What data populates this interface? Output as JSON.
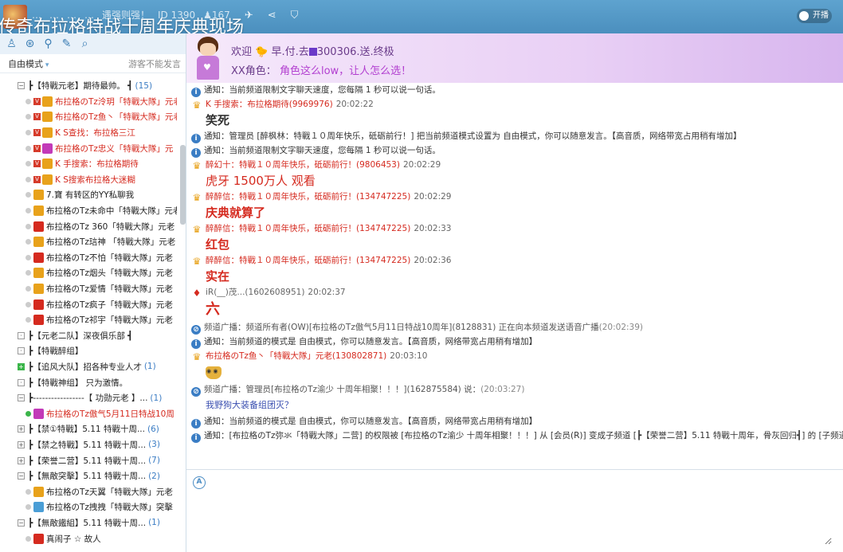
{
  "header": {
    "faded_text": [
      "…",
      "…",
      "…",
      "…",
      "遇强则强！",
      "ID 1390",
      "♟167"
    ],
    "channel_title": "传奇布拉格特战十周年庆典现场",
    "toggle_label": "开播"
  },
  "left": {
    "mode_label": "自由模式",
    "guest_notice": "游客不能发言",
    "tree": [
      {
        "kind": "group",
        "expander": "−",
        "text": "┣【特戰元老】期待最帅。 ┫",
        "count": "(15)",
        "color": "#222",
        "indent": 22
      },
      {
        "kind": "user",
        "text": "布拉格のTz泠玥「特戰大隊」元老",
        "color": "#d52a1f",
        "indent": 32,
        "v": true,
        "av": "#e8a21b"
      },
      {
        "kind": "user",
        "text": "布拉格のTz鱼丶「特戰大隊」元老",
        "color": "#d52a1f",
        "indent": 32,
        "v": true,
        "av": "#e8a21b"
      },
      {
        "kind": "user",
        "text": "K S查找：布拉格三江",
        "color": "#d52a1f",
        "indent": 32,
        "v": true,
        "av": "#e8a21b"
      },
      {
        "kind": "user",
        "text": "布拉格のTz忠义「特戰大隊」元",
        "color": "#d52a1f",
        "indent": 32,
        "v": true,
        "av": "#c23ab8"
      },
      {
        "kind": "user",
        "text": "K 手搜索：布拉格期待",
        "color": "#d52a1f",
        "indent": 32,
        "v": true,
        "av": "#e8a21b"
      },
      {
        "kind": "user",
        "text": "K S搜索布拉格大迷糊",
        "color": "#d52a1f",
        "indent": 32,
        "v": true,
        "av": "#e8a21b"
      },
      {
        "kind": "user",
        "text": "7.寶 有转区的YY私聊我",
        "color": "#222",
        "indent": 32,
        "v": false,
        "av": "#e8a21b"
      },
      {
        "kind": "user",
        "text": "布拉格のTz未命中「特戰大隊」元老",
        "color": "#222",
        "indent": 32,
        "v": false,
        "av": "#e8a21b"
      },
      {
        "kind": "user",
        "text": "布拉格のTz 360「特戰大隊」元老",
        "color": "#222",
        "indent": 32,
        "v": false,
        "av": "#d52a1f"
      },
      {
        "kind": "user",
        "text": "布拉格のTz琂神 「特戰大隊」元老",
        "color": "#222",
        "indent": 32,
        "v": false,
        "av": "#e8a21b"
      },
      {
        "kind": "user",
        "text": "布拉格のTz不怕「特戰大隊」元老",
        "color": "#222",
        "indent": 32,
        "v": false,
        "av": "#d52a1f"
      },
      {
        "kind": "user",
        "text": "布拉格のTz烟头「特戰大隊」元老",
        "color": "#222",
        "indent": 32,
        "v": false,
        "av": "#e8a21b"
      },
      {
        "kind": "user",
        "text": "布拉格のTz爱情「特戰大隊」元老",
        "color": "#222",
        "indent": 32,
        "v": false,
        "av": "#e8a21b"
      },
      {
        "kind": "user",
        "text": "布拉格のTz疯子「特戰大隊」元老",
        "color": "#222",
        "indent": 32,
        "v": false,
        "av": "#d52a1f"
      },
      {
        "kind": "user",
        "text": "布拉格のTz祁宇「特戰大隊」元老",
        "color": "#222",
        "indent": 32,
        "v": false,
        "av": "#d52a1f"
      },
      {
        "kind": "group",
        "expander": "·",
        "text": "┣【元老二队】深夜俱乐部 ┫",
        "count": "",
        "color": "#222",
        "indent": 22
      },
      {
        "kind": "group",
        "expander": "·",
        "text": "┣【特戰醉组】",
        "count": "",
        "color": "#222",
        "indent": 22
      },
      {
        "kind": "group",
        "expander": "+",
        "green": true,
        "text": "┣【追风大队】招各种专业人才",
        "count": "(1)",
        "color": "#222",
        "indent": 22
      },
      {
        "kind": "group",
        "expander": "·",
        "text": "┣【特戰神组】 只为激情。",
        "count": "",
        "color": "#222",
        "indent": 22
      },
      {
        "kind": "group",
        "expander": "−",
        "text": "┣-----------------【 功勋元老 】...",
        "count": "(1)",
        "color": "#222",
        "indent": 22
      },
      {
        "kind": "user",
        "text": "布拉格のTz傲气5月11日特战10周",
        "color": "#d52a1f",
        "indent": 32,
        "v": false,
        "av": "#c23ab8",
        "dotgreen": true
      },
      {
        "kind": "group",
        "expander": "+",
        "text": "┣【禁①特戰】5.11 特戰十周...",
        "count": "(6)",
        "color": "#222",
        "indent": 22
      },
      {
        "kind": "group",
        "expander": "+",
        "text": "┣【禁之特戰】5.11 特戰十周...",
        "count": "(3)",
        "color": "#222",
        "indent": 22
      },
      {
        "kind": "group",
        "expander": "+",
        "text": "┣【荣誉二营】5.11 特戰十周...",
        "count": "(7)",
        "color": "#222",
        "indent": 22
      },
      {
        "kind": "group",
        "expander": "−",
        "text": "┣【無敵突擊】5.11 特戰十周...",
        "count": "(2)",
        "color": "#222",
        "indent": 22
      },
      {
        "kind": "user",
        "text": "布拉格のTz天翼「特戰大隊」元老",
        "color": "#222",
        "indent": 32,
        "v": false,
        "av": "#e8a21b"
      },
      {
        "kind": "user",
        "text": "布拉格のTz拽拽「特戰大隊」突擊",
        "color": "#222",
        "indent": 32,
        "v": false,
        "av": "#4a9ed6"
      },
      {
        "kind": "group",
        "expander": "−",
        "text": "┣【無敵鐵組】5.11 特戰十周...",
        "count": "(1)",
        "color": "#222",
        "indent": 22
      },
      {
        "kind": "user",
        "text": "真闹子 ☆ 故人",
        "color": "#222",
        "indent": 32,
        "v": false,
        "av": "#d52a1f"
      }
    ]
  },
  "banner": {
    "welcome": "欢迎",
    "welcome_name": "早.付.去",
    "welcome_id": "300306.送.终极",
    "role_prefix": "XX角色：",
    "role_text": "角色这么low，让人怎么选！"
  },
  "chat": [
    {
      "type": "notice",
      "icon": "i",
      "text": "通知：当前频道限制文字聊天速度，您每隔 1 秒可以说一句话。"
    },
    {
      "type": "sender",
      "icon": "crown",
      "name": "K 手搜索：布拉格期待(9969976)",
      "time": "20:02:22"
    },
    {
      "type": "body",
      "text": "笑死",
      "color": "#333",
      "size": 15,
      "weight": "bold"
    },
    {
      "type": "notice",
      "icon": "i",
      "text": "通知：管理员 [醉枫林：特戰１０周年快乐，砥砺前行！] 把当前频道模式设置为 自由模式，你可以随意发言。【高音质，网络带宽占用稍有增加】"
    },
    {
      "type": "notice",
      "icon": "i",
      "text": "通知：当前频道限制文字聊天速度，您每隔 1 秒可以说一句话。"
    },
    {
      "type": "sender",
      "icon": "crown",
      "name": "醉幻十：特戰１０周年快乐，砥砺前行！(9806453)",
      "time": "20:02:29"
    },
    {
      "type": "body",
      "text": "虎牙  1500万人  观看",
      "color": "#d52a1f",
      "size": 15,
      "weight": "normal"
    },
    {
      "type": "sender",
      "icon": "crown",
      "name": "醉醉信：特戰１０周年快乐，砥砺前行！(134747225)",
      "time": "20:02:29"
    },
    {
      "type": "body",
      "text": "庆典就算了",
      "color": "#d52a1f",
      "size": 15,
      "weight": "bold"
    },
    {
      "type": "sender",
      "icon": "crown",
      "name": "醉醉信：特戰１０周年快乐，砥砺前行！(134747225)",
      "time": "20:02:33"
    },
    {
      "type": "body",
      "text": "红包",
      "color": "#d52a1f",
      "size": 15,
      "weight": "bold"
    },
    {
      "type": "sender",
      "icon": "crown",
      "name": "醉醉信：特戰１０周年快乐，砥砺前行！(134747225)",
      "time": "20:02:36"
    },
    {
      "type": "body",
      "text": "实在",
      "color": "#d52a1f",
      "size": 15,
      "weight": "bold"
    },
    {
      "type": "sender",
      "icon": "red",
      "name": "iR(__)茂...(1602608951)",
      "time": "20:02:37",
      "gray": true
    },
    {
      "type": "body",
      "text": "六",
      "color": "#d52a1f",
      "size": 18,
      "weight": "bold"
    },
    {
      "type": "broadcast",
      "icon": "r",
      "text": "频道广播：频道所有者(OW)[布拉格のTz傲气5月11日特战10周年](8128831) 正在向本频道发送语音广播",
      "time": "(20:02:39)"
    },
    {
      "type": "notice",
      "icon": "i",
      "text": "通知：当前频道的模式是 自由模式，你可以随意发言。【高音质，网络带宽占用稍有增加】"
    },
    {
      "type": "sender",
      "icon": "crown",
      "name": "布拉格のTz鱼丶「特戰大隊」元老(130802871)",
      "time": "20:03:10"
    },
    {
      "type": "emoji"
    },
    {
      "type": "broadcast",
      "icon": "r",
      "text": "频道广播：管理员[布拉格のTz渝少 十周年相聚！！！](162875584) 说：",
      "time": "(20:03:27)"
    },
    {
      "type": "body",
      "text": "我野狗大装备组团灭？",
      "color": "#3a4fb0",
      "size": 11,
      "weight": "normal"
    },
    {
      "type": "notice",
      "icon": "i",
      "text": "通知：当前频道的模式是 自由模式，你可以随意发言。【高音质，网络带宽占用稍有增加】"
    },
    {
      "type": "notice",
      "icon": "i",
      "text": "通知：[布拉格のTz弥氺「特戰大隊」二营] 的权限被 [布拉格のTz渝少 十周年相聚！！！] 从 [会员(R)] 变成子频道 [┣【荣誉二营】5.11 特戰十周年，骨灰回归┫] 的 [子频道管理员]"
    }
  ],
  "input": {
    "placeholder": ""
  }
}
